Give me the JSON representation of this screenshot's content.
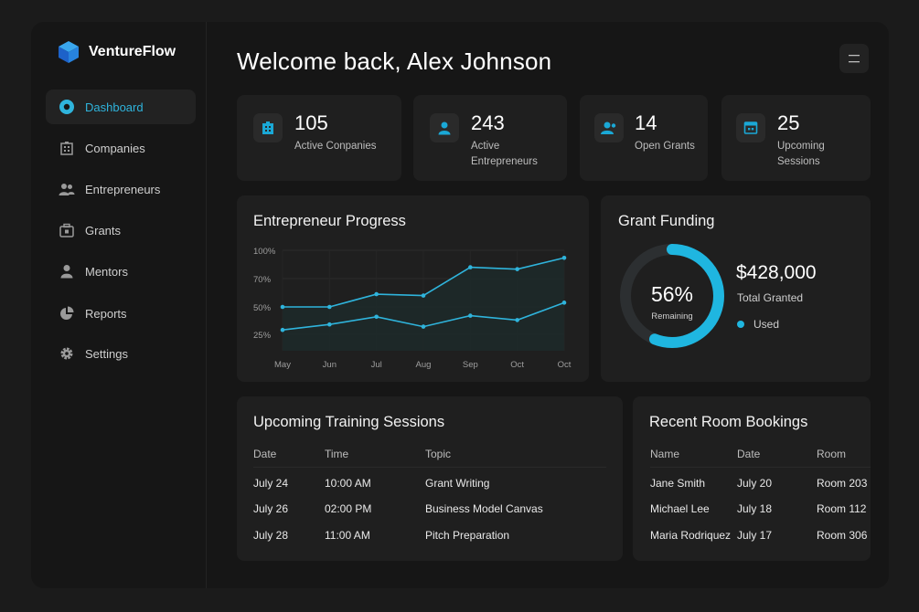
{
  "brand": {
    "name": "VentureFlow"
  },
  "sidebar": {
    "items": [
      {
        "label": "Dashboard",
        "icon": "dashboard-icon",
        "active": true
      },
      {
        "label": "Companies",
        "icon": "building-icon"
      },
      {
        "label": "Entrepreneurs",
        "icon": "users-icon"
      },
      {
        "label": "Grants",
        "icon": "briefcase-icon"
      },
      {
        "label": "Mentors",
        "icon": "user-icon"
      },
      {
        "label": "Reports",
        "icon": "pie-chart-icon"
      },
      {
        "label": "Settings",
        "icon": "gear-icon"
      }
    ]
  },
  "header": {
    "title": "Welcome back, Alex Johnson"
  },
  "stats": [
    {
      "value": "105",
      "label": "Active Conpanies",
      "icon": "building-icon"
    },
    {
      "value": "243",
      "label": "Active Entrepreneurs",
      "icon": "user-icon"
    },
    {
      "value": "14",
      "label": "Open Grants",
      "icon": "users-icon"
    },
    {
      "value": "25",
      "label": "Upcoming Sessions",
      "icon": "calendar-icon"
    }
  ],
  "chart_data": {
    "type": "line",
    "title": "Entrepreneur Progress",
    "categories": [
      "May",
      "Jun",
      "Jul",
      "Aug",
      "Sep",
      "Oct",
      "Oct"
    ],
    "y_ticks": [
      "100%",
      "70%",
      "50%",
      "25%"
    ],
    "series": [
      {
        "values": [
          50,
          50,
          59,
          58,
          82,
          80,
          92
        ]
      },
      {
        "values": [
          29,
          34,
          41,
          32,
          42,
          38,
          53
        ]
      }
    ],
    "grid": true,
    "colors": {
      "line": "#2fb4dc",
      "fill": "#1d2a2a"
    }
  },
  "funding": {
    "title": "Grant Funding",
    "percent_label": "56%",
    "percent_value": 56,
    "center_caption": "Remaining",
    "amount": "$428,000",
    "amount_caption": "Total Granted",
    "legend_label": "Used",
    "accent": "#1fb6e0"
  },
  "sessions": {
    "title": "Upcoming Training Sessions",
    "columns": [
      "Date",
      "Time",
      "Topic"
    ],
    "rows": [
      [
        "July 24",
        "10:00 AM",
        "Grant Writing"
      ],
      [
        "July 26",
        "02:00 PM",
        "Business Model Canvas"
      ],
      [
        "July 28",
        "11:00 AM",
        "Pitch Preparation"
      ]
    ]
  },
  "bookings": {
    "title": "Recent Room Bookings",
    "columns": [
      "Name",
      "Date",
      "Room"
    ],
    "rows": [
      [
        "Jane Smith",
        "July 20",
        "Room 203"
      ],
      [
        "Michael Lee",
        "July 18",
        "Room 112"
      ],
      [
        "Maria Rodriquez",
        "July 17",
        "Room 306"
      ]
    ]
  }
}
